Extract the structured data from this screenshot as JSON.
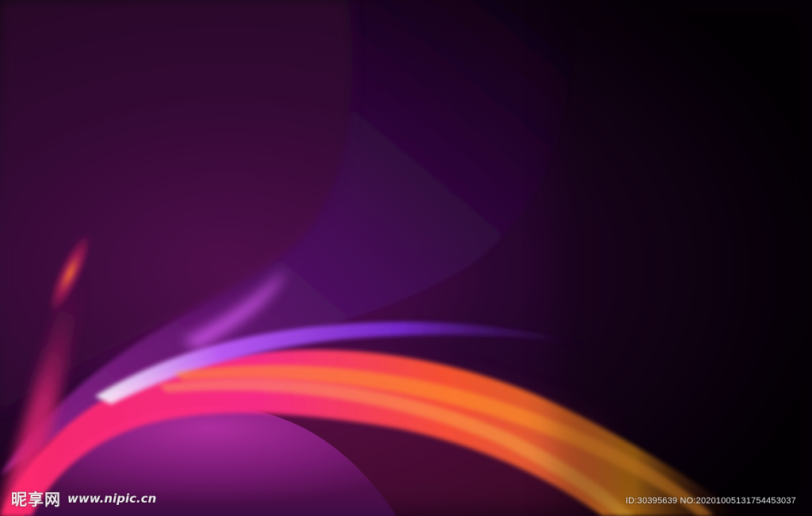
{
  "watermark": {
    "brand": "昵享网",
    "url": "www.nipic.cn"
  },
  "image_id_text": "ID:30395639 NO:20201005131754453037",
  "colors": {
    "background": "#050006",
    "purple": "#7a1a7e",
    "magenta": "#ff1f8f",
    "violet": "#9b3cff",
    "orange": "#ff7a1a",
    "gold": "#d9961e"
  }
}
